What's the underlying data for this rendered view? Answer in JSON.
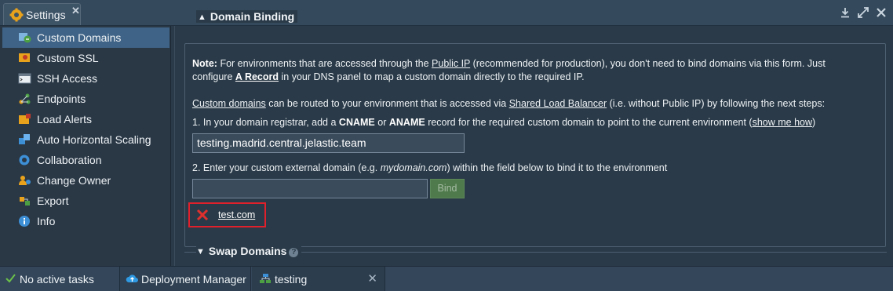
{
  "window": {
    "tab_title": "Settings",
    "tab_close": "✕"
  },
  "sidebar": {
    "items": [
      {
        "label": "Custom Domains",
        "icon": "custom-domains-icon",
        "active": true
      },
      {
        "label": "Custom SSL",
        "icon": "ssl-certificate-icon"
      },
      {
        "label": "SSH Access",
        "icon": "terminal-icon"
      },
      {
        "label": "Endpoints",
        "icon": "endpoints-icon"
      },
      {
        "label": "Load Alerts",
        "icon": "load-alerts-icon"
      },
      {
        "label": "Auto Horizontal Scaling",
        "icon": "scaling-icon"
      },
      {
        "label": "Collaboration",
        "icon": "collaboration-icon"
      },
      {
        "label": "Change Owner",
        "icon": "change-owner-icon"
      },
      {
        "label": "Export",
        "icon": "export-icon"
      },
      {
        "label": "Info",
        "icon": "info-icon"
      }
    ]
  },
  "domain_binding": {
    "title": "Domain Binding",
    "note_label": "Note:",
    "note_part1": "For environments that are accessed through the",
    "public_ip_link": "Public IP",
    "note_part2": "(recommended for production), you don't need to bind domains via this form. Just",
    "note_part3": "configure",
    "a_record_link": "A Record",
    "note_part4": "in your DNS panel to map a custom domain directly to the required IP.",
    "custom_domains_link": "Custom domains",
    "routing_part1": "can be routed to your environment that is accessed via",
    "slb_link": "Shared Load Balancer",
    "routing_part2": "(i.e. without Public IP) by following the next steps:",
    "step1_part1": "1. In your domain registrar, add a",
    "step1_cname": "CNAME",
    "step1_or": "or",
    "step1_aname": "ANAME",
    "step1_part2": "record for the required custom domain to point to the current environment (",
    "show_me_how": "show me how",
    "step1_close": ")",
    "environment_domain": "testing.madrid.central.jelastic.team",
    "step2_part1": "2. Enter your custom external domain (e.g.",
    "step2_example": "mydomain.com",
    "step2_part2": ") within the field below to bind it to the environment",
    "domain_input_value": "",
    "bind_label": "Bind",
    "bound_domains": [
      "test.com"
    ]
  },
  "swap_domains": {
    "title": "Swap Domains"
  },
  "taskbar": {
    "tasks_label": "No active tasks",
    "deployment_manager_label": "Deployment Manager",
    "testing_label": "testing",
    "close": "✕"
  },
  "colors": {
    "active_item": "#3f6386",
    "highlight_border": "#e0202a",
    "bind_button": "#4f7a4c"
  }
}
